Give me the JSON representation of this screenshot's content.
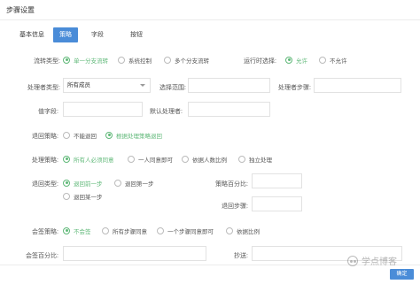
{
  "window": {
    "title": "步骤设置"
  },
  "tabs": {
    "section_label": "基本信息",
    "items": [
      {
        "label": "策略"
      },
      {
        "label": "字段"
      },
      {
        "label": "按钮"
      }
    ]
  },
  "form": {
    "flow_type": {
      "label": "流转类型:",
      "options": [
        "单一分支流转",
        "系统控制",
        "多个分支流转"
      ]
    },
    "runtime_select": {
      "label": "运行时选择:",
      "options": [
        "允许",
        "不允许"
      ]
    },
    "handler_type": {
      "label": "处理者类型:",
      "value": "所有成员"
    },
    "select_range": {
      "label": "选择范围:",
      "value": ""
    },
    "handler_step": {
      "label": "处理者步骤:",
      "value": ""
    },
    "value_field": {
      "label": "值字段:",
      "value": ""
    },
    "default_handler": {
      "label": "默认处理者:",
      "value": ""
    },
    "return_strategy": {
      "label": "退回策略:",
      "options": [
        "不能退回",
        "根据处理策略退回"
      ]
    },
    "handle_strategy": {
      "label": "处理策略:",
      "options": [
        "所有人必须同意",
        "一人同意即可",
        "依据人数比例",
        "独立处理"
      ]
    },
    "return_type": {
      "label": "退回类型:",
      "options": [
        "退回前一步",
        "退回第一步",
        "退回某一步"
      ]
    },
    "strategy_percent": {
      "label": "策略百分比:",
      "value": ""
    },
    "return_step": {
      "label": "退回步骤:",
      "value": ""
    },
    "countersign_strategy": {
      "label": "会签策略:",
      "options": [
        "不会签",
        "所有步骤同意",
        "一个步骤同意即可",
        "依据比例"
      ]
    },
    "countersign_percent": {
      "label": "会签百分比:",
      "value": ""
    },
    "cc": {
      "label": "抄送:",
      "value": ""
    }
  },
  "footer": {
    "confirm_label": "确定"
  },
  "watermark": {
    "text": "学点博客"
  },
  "colors": {
    "accent": "#4a8cd8",
    "checked": "#5fb878"
  }
}
